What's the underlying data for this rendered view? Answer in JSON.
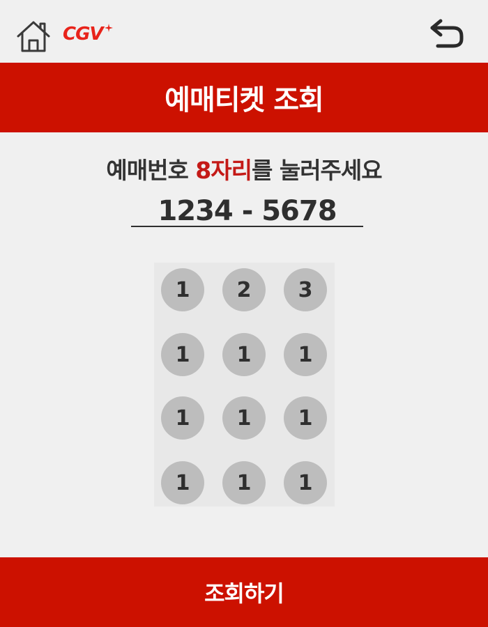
{
  "colors": {
    "accent": "#cc1100",
    "background": "#f0f0f0",
    "text": "#333333",
    "highlight": "#c41a17",
    "key_fill": "#bdbdbd"
  },
  "header": {
    "home_icon": "home-icon",
    "logo_text": "CGV",
    "back_icon": "undo-arrow-icon"
  },
  "title": "예매티켓 조회",
  "instruction": {
    "prefix": "예매번호 ",
    "highlight": "8자리",
    "suffix": "를 눌러주세요"
  },
  "code_display": "1234 - 5678",
  "keypad": {
    "keys": [
      "1",
      "2",
      "3",
      "1",
      "1",
      "1",
      "1",
      "1",
      "1",
      "1",
      "1",
      "1"
    ]
  },
  "submit_label": "조회하기"
}
